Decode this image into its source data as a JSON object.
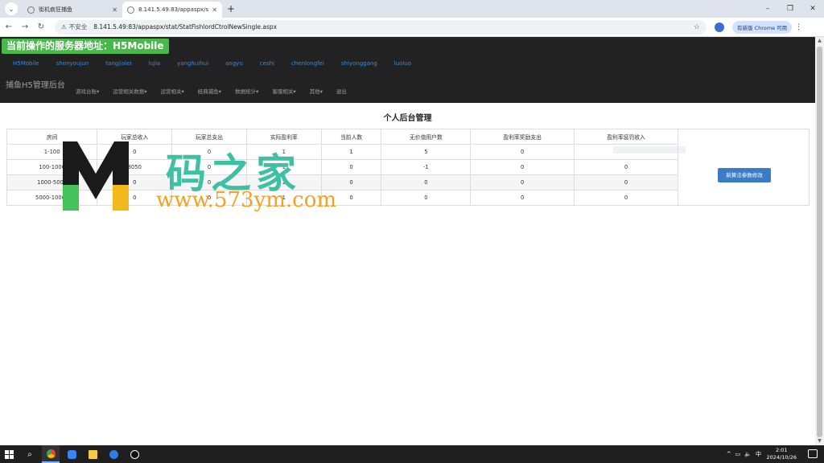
{
  "browser": {
    "tabs": [
      {
        "label": "街机疯狂捕鱼",
        "active": false
      },
      {
        "label": "8.141.5.49:83/appaspx/stat/",
        "active": true
      }
    ],
    "address": {
      "security_label": "不安全",
      "url": "8.141.5.49:83/appaspx/stat/StatFishlordCtrolNewSingle.aspx"
    },
    "chrome_pill": "有新版 Chrome 可用"
  },
  "header": {
    "server_badge": "当前操作的服务器地址：H5Mobile",
    "servers": [
      "H5Mobile",
      "shenyoujun",
      "tangjialei",
      "lujia",
      "yanghuihui",
      "angyu",
      "ceshi",
      "chenlongfei",
      "shiyonggang",
      "luoluo"
    ],
    "brand": "捕鱼H5管理后台",
    "menu": [
      "游戏台账▾",
      "运营相关数据▾",
      "运营相关▾",
      "经典捕鱼▾",
      "数据统计▾",
      "客服相关▾",
      "其他▾",
      "退出"
    ]
  },
  "main": {
    "title": "个人后台管理",
    "table": {
      "headers": [
        "房间",
        "玩家总收入",
        "玩家总支出",
        "实际盈利率",
        "当前人数",
        "无价值用户数",
        "盈利率奖励支出",
        "盈利率惩罚收入"
      ],
      "rows": [
        [
          "1-100",
          "0",
          "0",
          "1",
          "1",
          "5",
          "0",
          "0"
        ],
        [
          "100-1000",
          "8050",
          "0",
          "1",
          "0",
          "-1",
          "0",
          "0"
        ],
        [
          "1000-5000",
          "0",
          "0",
          "1",
          "0",
          "0",
          "0",
          "0"
        ],
        [
          "5000-10000",
          "0",
          "0",
          "1",
          "0",
          "0",
          "0",
          "0"
        ]
      ]
    },
    "side_button": "新算法参数修改"
  },
  "watermark": {
    "letter": "M",
    "chinese": "码之家",
    "url": "www.573ym.com"
  },
  "taskbar": {
    "time": "2:01",
    "date": "2024/10/26",
    "ime": "中"
  }
}
